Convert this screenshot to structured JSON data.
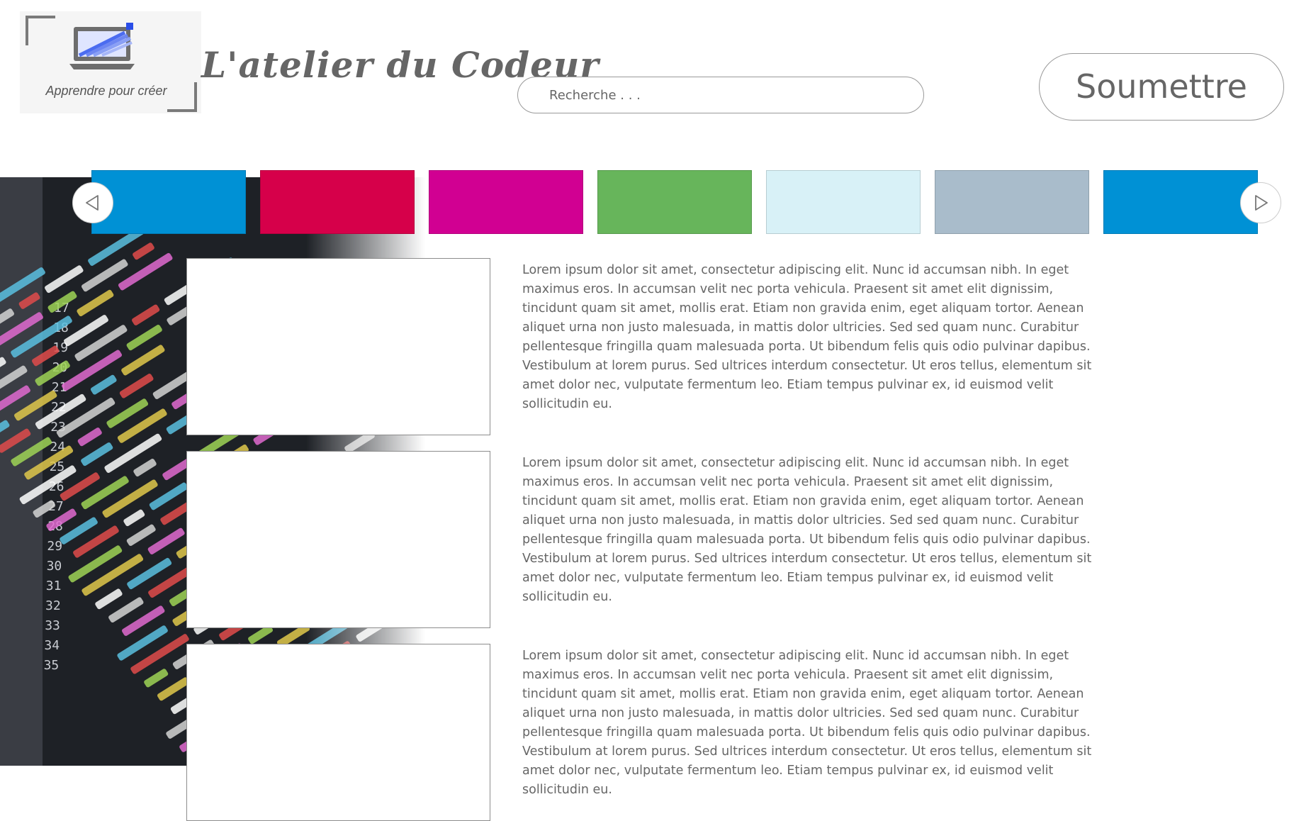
{
  "header": {
    "site_title": "L'atelier du Codeur",
    "logo_tagline": "Apprendre pour créer",
    "search_placeholder": "Recherche . . .",
    "submit_label": "Soumettre"
  },
  "carousel": {
    "tiles": [
      {
        "name": "category-tile-1",
        "color": "#0091d5"
      },
      {
        "name": "category-tile-2",
        "color": "#d6004a"
      },
      {
        "name": "category-tile-3",
        "color": "#d10092"
      },
      {
        "name": "category-tile-4",
        "color": "#67b55b"
      },
      {
        "name": "category-tile-5",
        "color": "#d8f1f7"
      },
      {
        "name": "category-tile-6",
        "color": "#a9bccb"
      },
      {
        "name": "category-tile-7",
        "color": "#0091d5"
      }
    ],
    "prev_icon": "triangle-left-icon",
    "next_icon": "triangle-right-icon"
  },
  "articles": [
    {
      "text": "Lorem ipsum dolor sit amet, consectetur adipiscing elit. Nunc id accumsan nibh. In eget maximus eros. In accumsan velit nec porta vehicula. Praesent sit amet elit dignissim, tincidunt quam sit amet, mollis erat. Etiam non gravida enim, eget aliquam tortor. Aenean aliquet urna non justo malesuada, in mattis dolor ultricies. Sed sed quam nunc. Curabitur pellentesque fringilla quam malesuada porta. Ut bibendum felis quis odio pulvinar dapibus. Vestibulum at lorem purus. Sed ultrices interdum consectetur. Ut eros tellus, elementum sit amet dolor nec, vulputate fermentum leo. Etiam tempus pulvinar ex, id euismod velit sollicitudin eu."
    },
    {
      "text": "Lorem ipsum dolor sit amet, consectetur adipiscing elit. Nunc id accumsan nibh. In eget maximus eros. In accumsan velit nec porta vehicula. Praesent sit amet elit dignissim, tincidunt quam sit amet, mollis erat. Etiam non gravida enim, eget aliquam tortor. Aenean aliquet urna non justo malesuada, in mattis dolor ultricies. Sed sed quam nunc. Curabitur pellentesque fringilla quam malesuada porta. Ut bibendum felis quis odio pulvinar dapibus. Vestibulum at lorem purus. Sed ultrices interdum consectetur. Ut eros tellus, elementum sit amet dolor nec, vulputate fermentum leo. Etiam tempus pulvinar ex, id euismod velit sollicitudin eu."
    },
    {
      "text": "Lorem ipsum dolor sit amet, consectetur adipiscing elit. Nunc id accumsan nibh. In eget maximus eros. In accumsan velit nec porta vehicula. Praesent sit amet elit dignissim, tincidunt quam sit amet, mollis erat. Etiam non gravida enim, eget aliquam tortor. Aenean aliquet urna non justo malesuada, in mattis dolor ultricies. Sed sed quam nunc. Curabitur pellentesque fringilla quam malesuada porta. Ut bibendum felis quis odio pulvinar dapibus. Vestibulum at lorem purus. Sed ultrices interdum consectetur. Ut eros tellus, elementum sit amet dolor nec, vulputate fermentum leo. Etiam tempus pulvinar ex, id euismod velit sollicitudin eu."
    }
  ],
  "background": {
    "image": "code-editor-photo",
    "line_numbers": [
      "17",
      "18",
      "19",
      "20",
      "21",
      "22",
      "23",
      "24",
      "25",
      "26",
      "27",
      "28",
      "29",
      "30",
      "31",
      "32",
      "33",
      "34",
      "35"
    ]
  }
}
